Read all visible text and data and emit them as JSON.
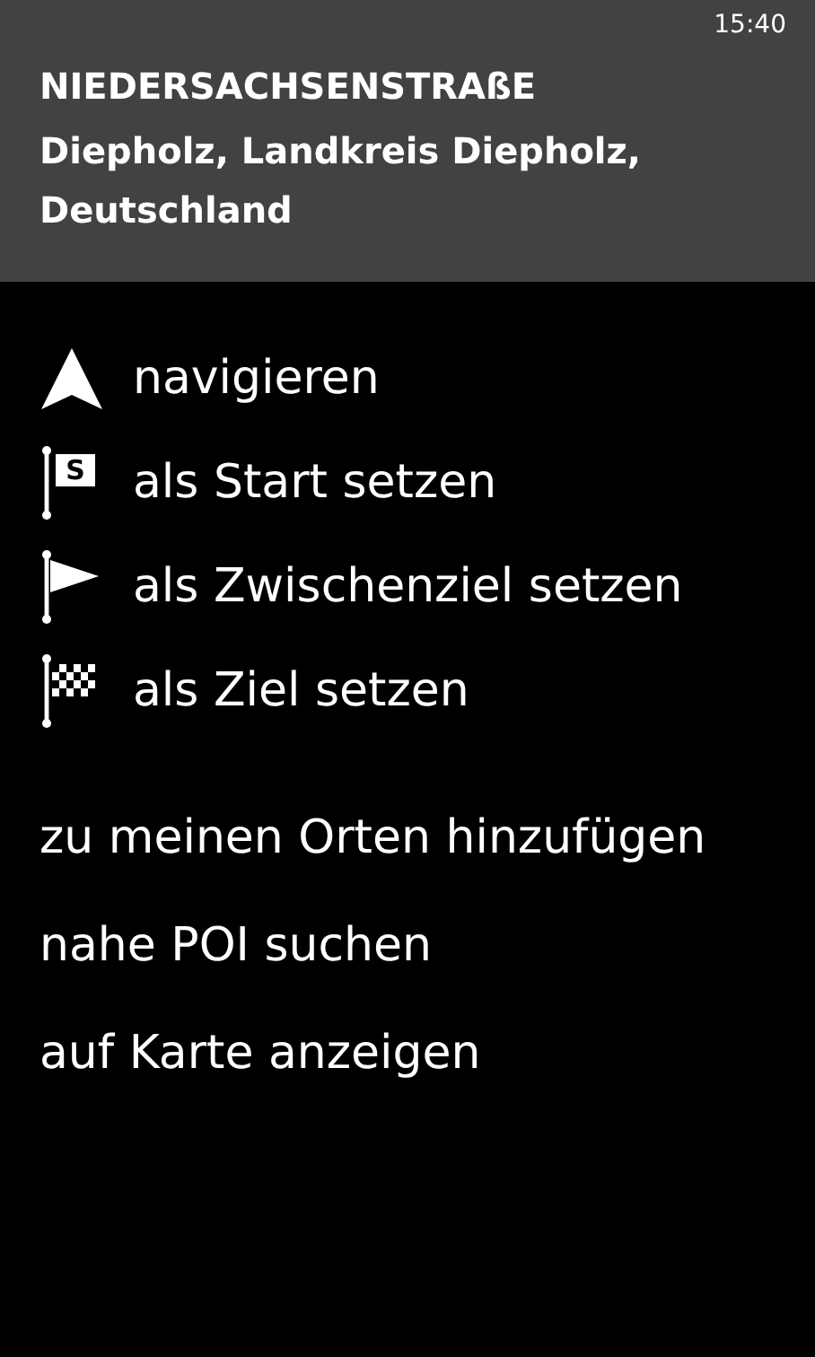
{
  "status_bar": {
    "time": "15:40"
  },
  "header": {
    "title": "NIEDERSACHSENSTRAßE",
    "subtitle": "Diepholz, Landkreis Diepholz, Deutschland"
  },
  "actions": [
    {
      "kind": "arrow",
      "label": "navigieren"
    },
    {
      "kind": "start-flag",
      "badge": "S",
      "label": "als Start setzen"
    },
    {
      "kind": "via-flag",
      "label": "als Zwischenziel setzen"
    },
    {
      "kind": "finish-flag",
      "label": "als Ziel setzen"
    }
  ],
  "links": [
    "zu meinen Orten hinzufügen",
    "nahe POI suchen",
    "auf Karte anzeigen"
  ]
}
